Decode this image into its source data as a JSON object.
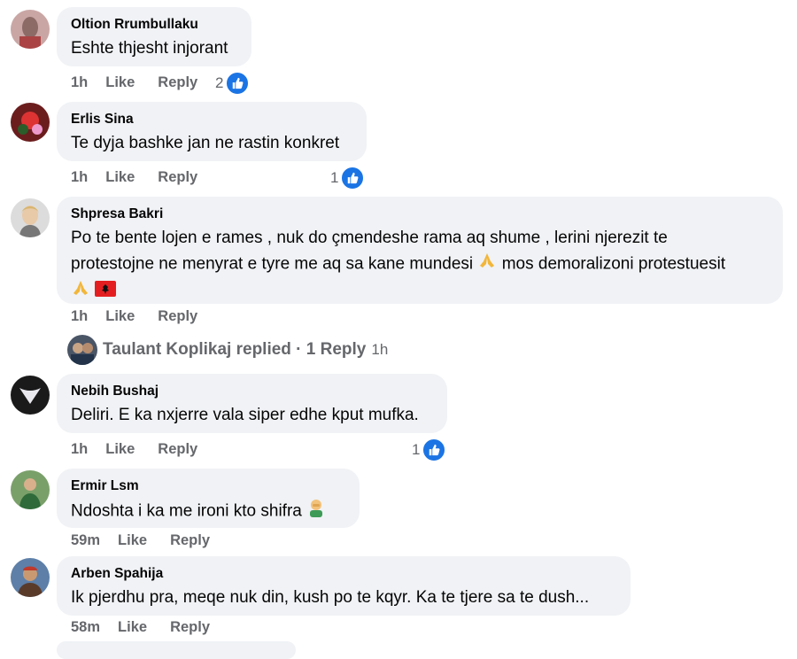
{
  "comments": [
    {
      "author": "Oltion Rrumbullaku",
      "text": "Eshte thjesht injorant",
      "time": "1h",
      "like": "Like",
      "reply": "Reply",
      "reactions": "2"
    },
    {
      "author": "Erlis Sina",
      "text": "Te dyja bashke jan ne rastin konkret",
      "time": "1h",
      "like": "Like",
      "reply": "Reply",
      "reactions": "1"
    },
    {
      "author": "Shpresa Bakri",
      "text_line1": "Po te bente lojen e rames , nuk do çmendeshe rama aq shume , lerini njerezit te",
      "text_line2": "protestojne ne menyrat e tyre me aq sa kane mundesi",
      "text_line2b": "mos demoralizoni protestuesit",
      "time": "1h",
      "like": "Like",
      "reply": "Reply"
    },
    {
      "author": "Nebih Bushaj",
      "text": "Deliri. E ka nxjerre vala siper edhe kput mufka.",
      "time": "1h",
      "like": "Like",
      "reply": "Reply",
      "reactions": "1"
    },
    {
      "author": "Ermir Lsm",
      "text": "Ndoshta i ka me ironi kto shifra",
      "time": "59m",
      "like": "Like",
      "reply": "Reply"
    },
    {
      "author": "Arben Spahija",
      "text": "Ik pjerdhu pra, meqe nuk din, kush po te kqyr. Ka te tjere sa te dush...",
      "time": "58m",
      "like": "Like",
      "reply": "Reply"
    }
  ],
  "replied": {
    "label": "Taulant Koplikaj replied · 1 Reply",
    "time": "1h"
  },
  "colors": {
    "bubble": "#f0f2f5",
    "meta": "#65676b",
    "like_blue": "#1b74e4"
  }
}
